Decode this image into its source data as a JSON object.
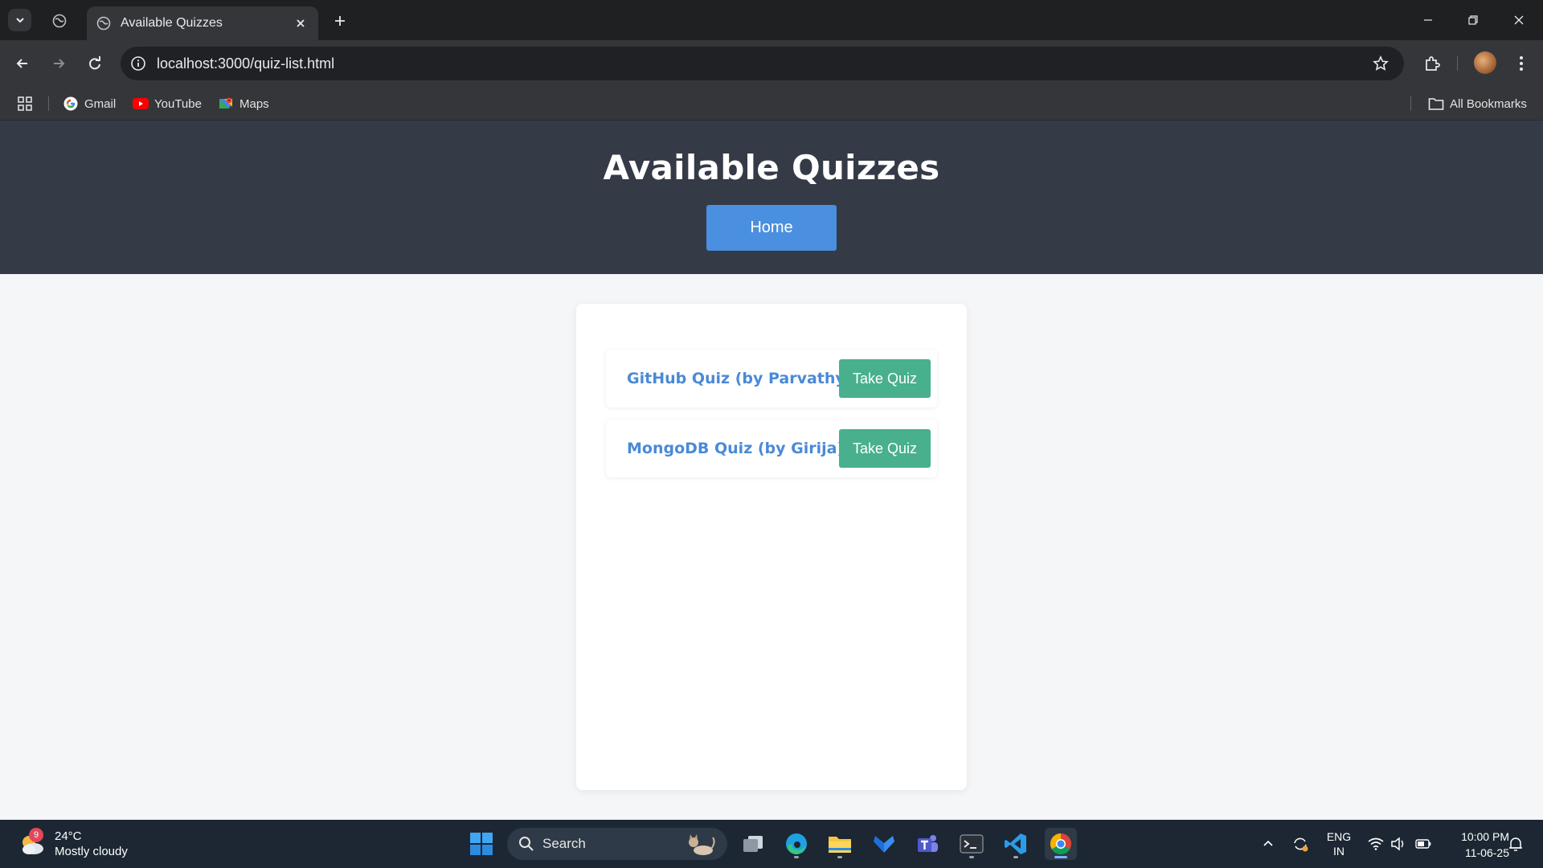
{
  "browser": {
    "tab_title": "Available Quizzes",
    "url": "localhost:3000/quiz-list.html",
    "bookmarks": [
      {
        "label": "Gmail",
        "icon": "gmail-icon"
      },
      {
        "label": "YouTube",
        "icon": "youtube-icon"
      },
      {
        "label": "Maps",
        "icon": "maps-icon"
      }
    ],
    "all_bookmarks": "All Bookmarks"
  },
  "page": {
    "title": "Available Quizzes",
    "home_label": "Home",
    "quizzes": [
      {
        "name": "GitHub Quiz (by Parvathy)",
        "action": "Take Quiz"
      },
      {
        "name": "MongoDB Quiz (by Girija)",
        "action": "Take Quiz"
      }
    ]
  },
  "taskbar": {
    "weather_badge": "9",
    "temperature": "24°C",
    "condition": "Mostly cloudy",
    "search_placeholder": "Search",
    "lang_line1": "ENG",
    "lang_line2": "IN",
    "time": "10:00 PM",
    "date": "11-06-25"
  },
  "colors": {
    "header_bg": "#343a46",
    "home_button": "#4a8fe0",
    "take_quiz_button": "#48b08c",
    "quiz_link": "#4a8ad6"
  }
}
